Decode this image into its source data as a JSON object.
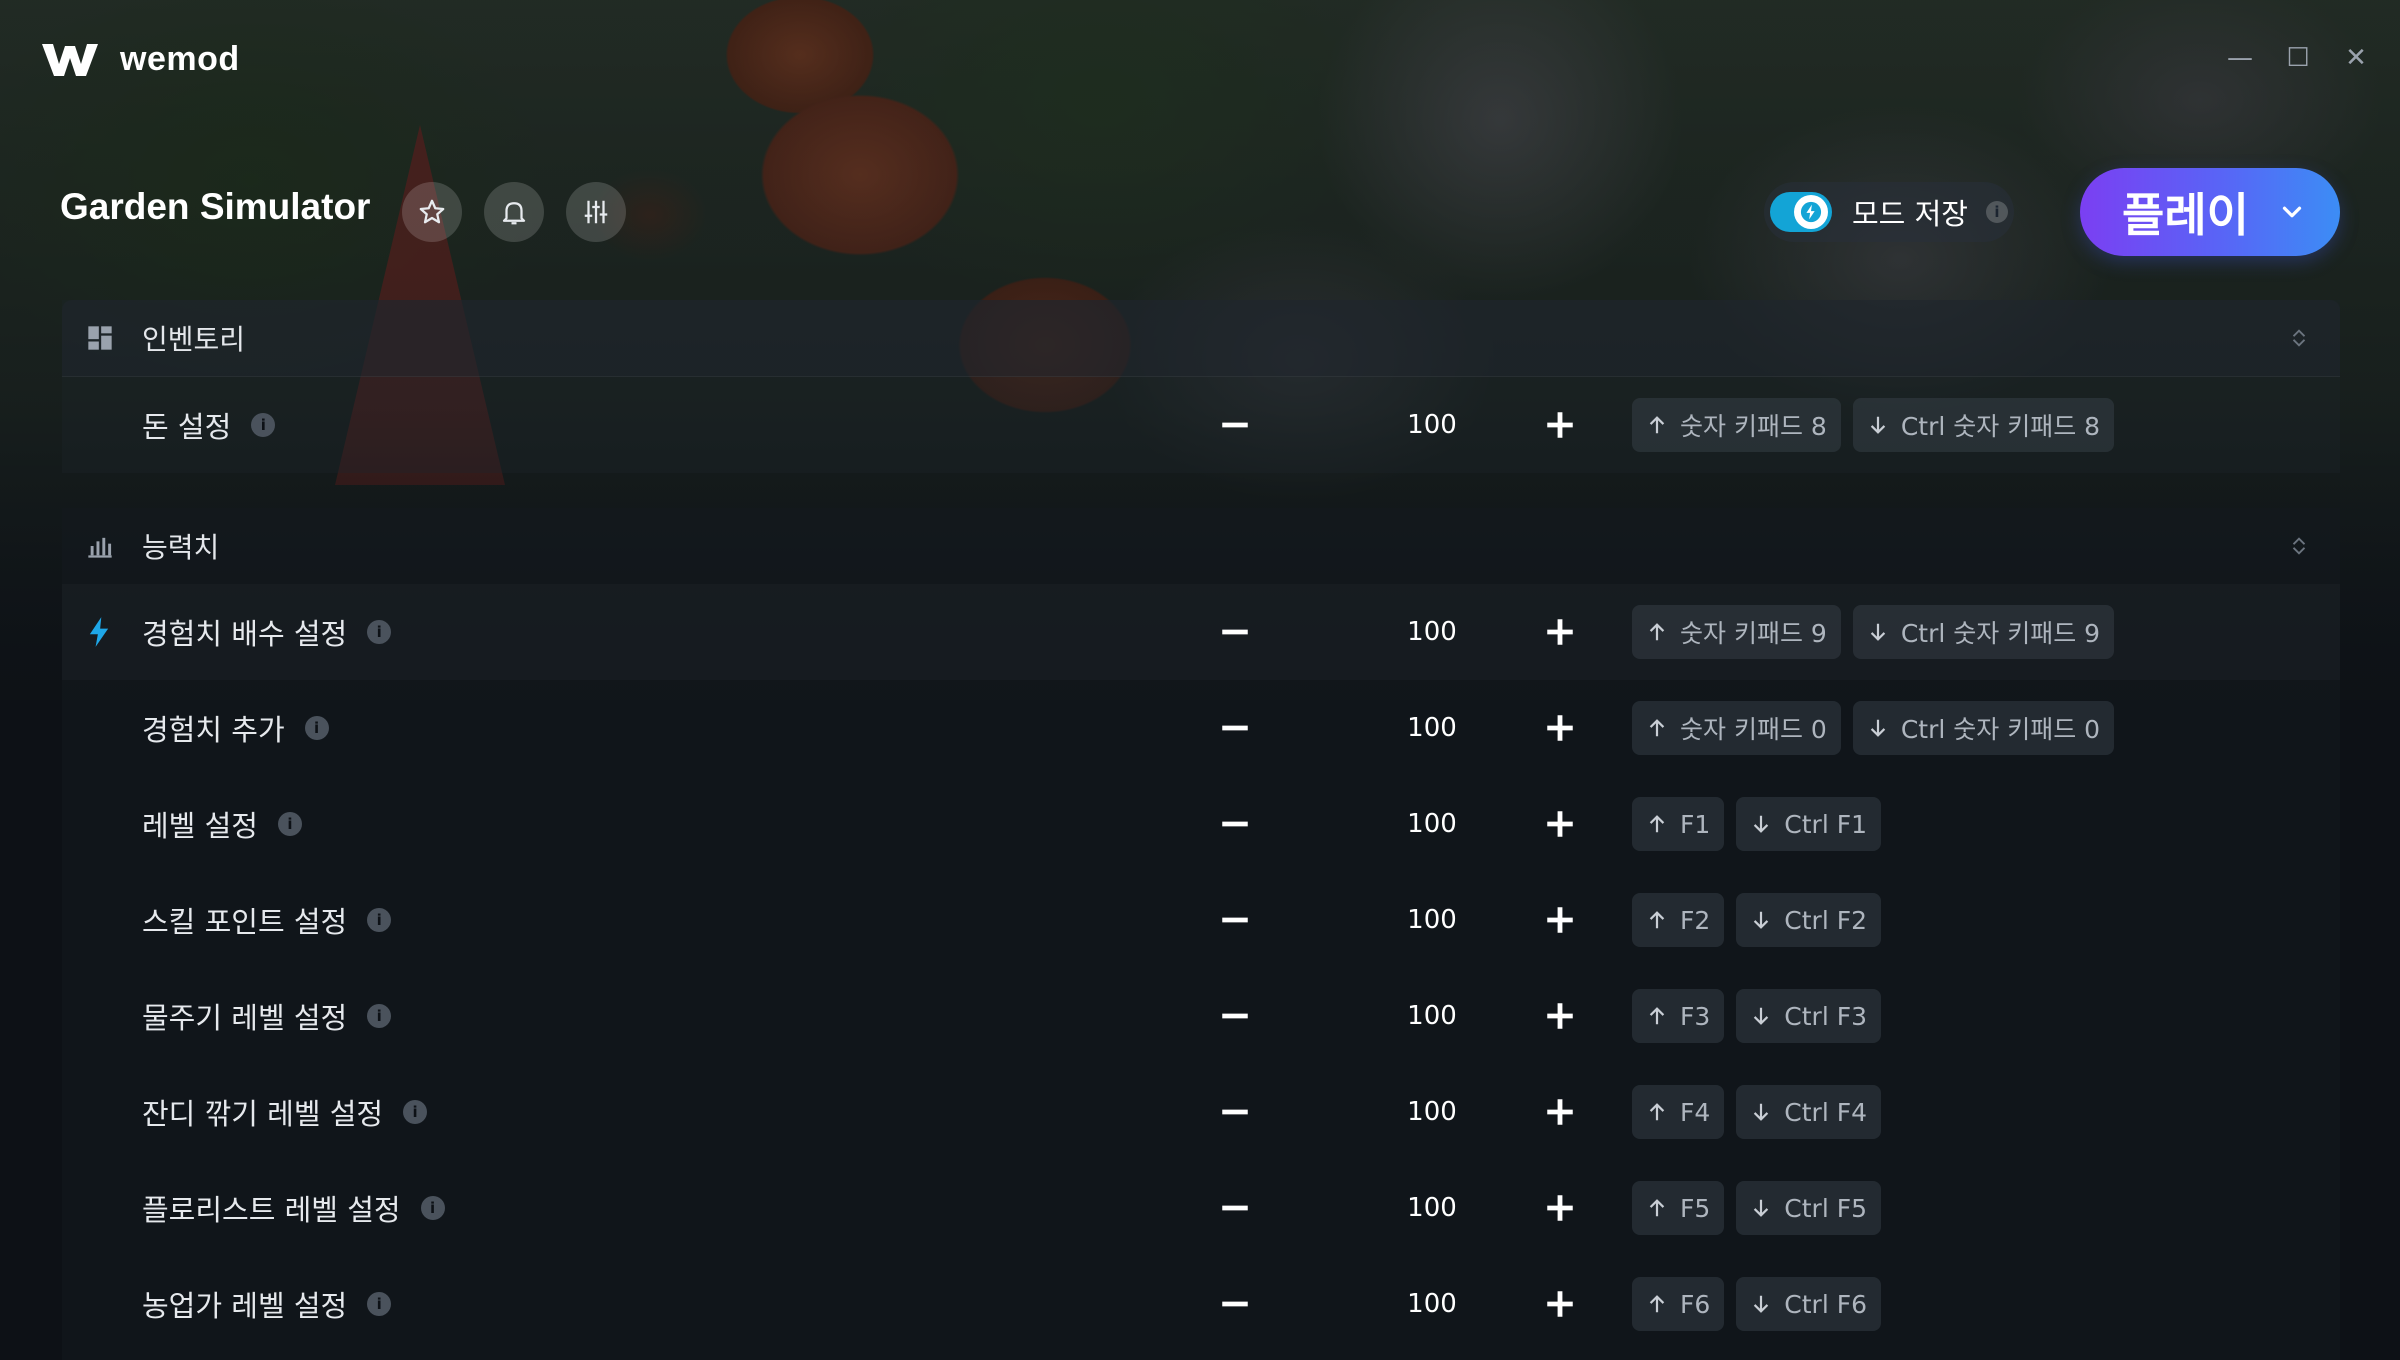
{
  "app": {
    "name": "wemod"
  },
  "window_controls": {
    "minimize": "—",
    "maximize": "☐",
    "close": "✕"
  },
  "header": {
    "title": "Garden Simulator",
    "mod_save_label": "모드 저장",
    "mod_save_info": "i",
    "play_label": "플레이"
  },
  "sections": [
    {
      "title": "인벤토리",
      "rows": [
        {
          "name": "돈 설정",
          "value": "100",
          "inc_key": "숫자 키패드 8",
          "dec_key": "Ctrl 숫자 키패드 8"
        }
      ]
    },
    {
      "title": "능력치",
      "rows": [
        {
          "name": "경험치 배수 설정",
          "value": "100",
          "inc_key": "숫자 키패드 9",
          "dec_key": "Ctrl 숫자 키패드 9"
        },
        {
          "name": "경험치 추가",
          "value": "100",
          "inc_key": "숫자 키패드 0",
          "dec_key": "Ctrl 숫자 키패드 0"
        },
        {
          "name": "레벨 설정",
          "value": "100",
          "inc_key": "F1",
          "dec_key": "Ctrl F1"
        },
        {
          "name": "스킬 포인트 설정",
          "value": "100",
          "inc_key": "F2",
          "dec_key": "Ctrl F2"
        },
        {
          "name": "물주기 레벨 설정",
          "value": "100",
          "inc_key": "F3",
          "dec_key": "Ctrl F3"
        },
        {
          "name": "잔디 깎기 레벨 설정",
          "value": "100",
          "inc_key": "F4",
          "dec_key": "Ctrl F4"
        },
        {
          "name": "플로리스트 레벨 설정",
          "value": "100",
          "inc_key": "F5",
          "dec_key": "Ctrl F5"
        },
        {
          "name": "농업가 레벨 설정",
          "value": "100",
          "inc_key": "F6",
          "dec_key": "Ctrl F6"
        }
      ]
    }
  ],
  "colors": {
    "accent": "#13a4d6",
    "play_start": "#7b3ff2",
    "play_end": "#3c8df5",
    "bolt": "#1ea7e8"
  }
}
